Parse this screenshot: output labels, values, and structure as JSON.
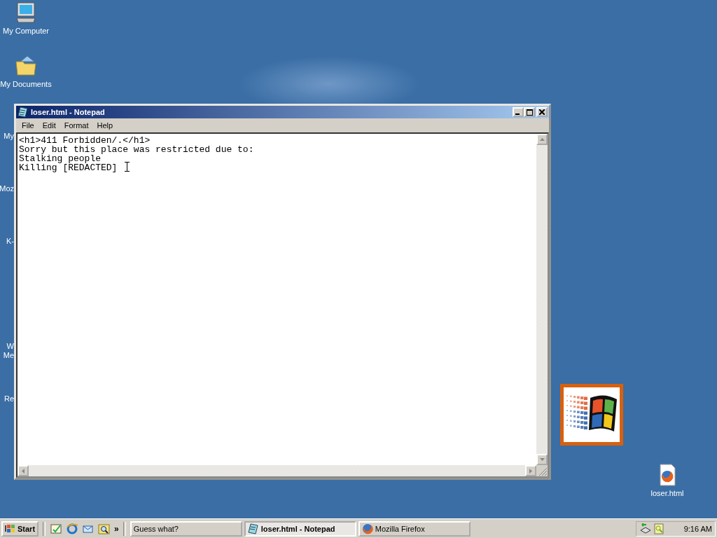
{
  "desktop_icons": [
    {
      "label": "My Computer",
      "kind": "computer"
    },
    {
      "label": "My Documents",
      "kind": "documents"
    },
    {
      "label": "loser.html",
      "kind": "html"
    }
  ],
  "partly_hidden_icon_labels": [
    {
      "lines": [
        "My"
      ]
    },
    {
      "lines": [
        "Moz"
      ]
    },
    {
      "lines": [
        "K-"
      ]
    },
    {
      "lines": [
        "W",
        "Me"
      ]
    },
    {
      "lines": [
        "Re"
      ]
    }
  ],
  "notepad": {
    "title": "loser.html - Notepad",
    "menu": [
      "File",
      "Edit",
      "Format",
      "Help"
    ],
    "lines": [
      "<h1>411 Forbidden/.</h1>",
      "Sorry but this place was restricted due to:",
      "Stalking people",
      "Killing [REDACTED] "
    ]
  },
  "taskbar": {
    "start": "Start",
    "more": "»",
    "quick_launch": [
      {
        "kind": "desktop"
      },
      {
        "kind": "browser"
      },
      {
        "kind": "mail"
      },
      {
        "kind": "search"
      }
    ],
    "tasks": [
      {
        "label": "Guess what?",
        "selected": false,
        "kind": "generic"
      },
      {
        "label": "loser.html - Notepad",
        "selected": true,
        "kind": "notepad"
      },
      {
        "label": "Mozilla Firefox",
        "selected": false,
        "kind": "firefox"
      }
    ],
    "clock": "9:16 AM"
  }
}
